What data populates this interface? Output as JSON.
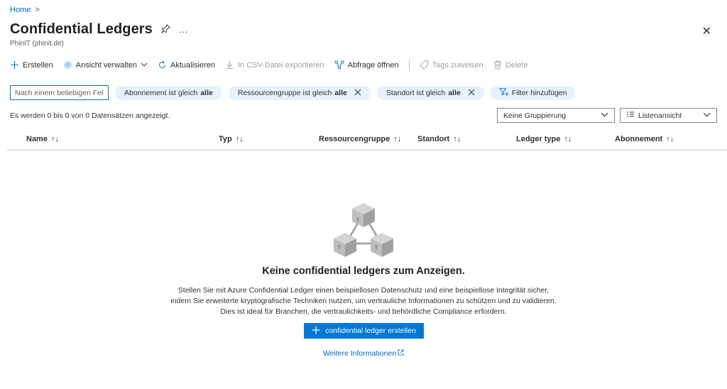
{
  "breadcrumb": {
    "home": "Home",
    "separator": ">"
  },
  "header": {
    "title": "Confidential Ledgers",
    "subtitle": "PhinIT (phinit.de)",
    "pin_icon": "pin-icon",
    "more_icon": "…",
    "close_icon": "✕"
  },
  "toolbar": {
    "create": "Erstellen",
    "manage_view": "Ansicht verwalten",
    "refresh": "Aktualisieren",
    "export_csv": "In CSV-Datei exportieren",
    "open_query": "Abfrage öffnen",
    "assign_tags": "Tags zuweisen",
    "delete": "Delete"
  },
  "filters": {
    "search_placeholder": "Nach einem beliebigen Feld filtern...",
    "subscription_prefix": "Abonnement ist gleich",
    "subscription_value": "alle",
    "resource_group_prefix": "Ressourcengruppe ist gleich",
    "resource_group_value": "alle",
    "location_prefix": "Standort ist gleich",
    "location_value": "alle",
    "add_filter": "Filter hinzufügen"
  },
  "results": {
    "count_text": "Es werden 0 bis 0 von 0 Datensätzen angezeigt.",
    "grouping": "Keine Gruppierung",
    "view": "Listenansicht"
  },
  "table": {
    "columns": [
      "Name",
      "Typ",
      "Ressourcengruppe",
      "Standort",
      "Ledger type",
      "Abonnement"
    ]
  },
  "empty_state": {
    "title": "Keine confidential ledgers zum Anzeigen.",
    "line1": "Stellen Sie mit Azure Confidential Ledger einen beispiellosen Datenschutz und eine beispiellose Integrität sicher,",
    "line2": "indem Sie erweiterte kryptografische Techniken nutzen, um vertrauliche Informationen zu schützen und zu validieren.",
    "line3": "Dies ist ideal für Branchen, die vertraulichkeits- und behördliche Compliance erfordern.",
    "create_button": "confidential ledger erstellen",
    "more_info": "Weitere Informationen"
  },
  "colors": {
    "accent": "#0078d4",
    "pill_bg": "#e5f1fb",
    "link": "#0067b8"
  }
}
